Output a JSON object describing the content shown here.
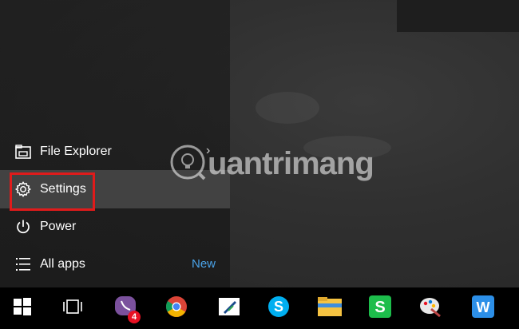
{
  "start_menu": {
    "items": [
      {
        "label": "File Explorer",
        "icon": "file-explorer-icon"
      },
      {
        "label": "Settings",
        "icon": "gear-icon",
        "highlighted": true
      },
      {
        "label": "Power",
        "icon": "power-icon"
      },
      {
        "label": "All apps",
        "icon": "list-icon",
        "badge": "New"
      }
    ]
  },
  "watermark": {
    "text": "uantrimang"
  },
  "taskbar": {
    "viber_badge": "4",
    "apps": [
      "windows-start-icon",
      "task-view-icon",
      "viber-icon",
      "chrome-icon",
      "quill-app-icon",
      "skype-icon",
      "file-explorer-folder-icon",
      "spreadsheet-s-icon",
      "paint-icon",
      "writer-w-icon"
    ]
  },
  "colors": {
    "highlight_border": "#e01b1b",
    "new_label": "#4aa3e8"
  }
}
